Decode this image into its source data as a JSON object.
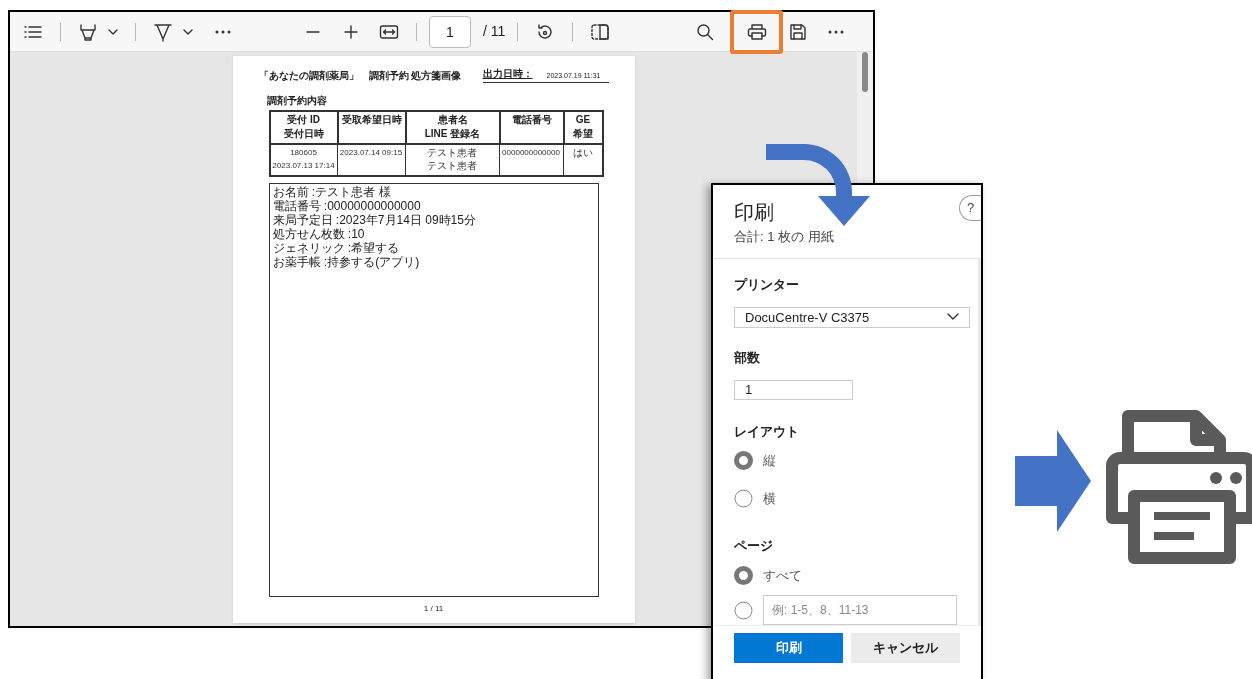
{
  "viewer": {
    "toolbar": {
      "page_number": "1",
      "page_total": "/ 11",
      "print_highlighted": true
    },
    "document": {
      "header_title": "「あなたの調剤薬局」　調剤予約 処方箋画像",
      "output_label": "出力日時：",
      "output_value": "2023.07.19 11:31",
      "section_title": "調剤予約内容",
      "table": {
        "columns": [
          {
            "lines": [
              "受付 ID",
              "受付日時"
            ]
          },
          {
            "lines": [
              "受取希望日時"
            ]
          },
          {
            "lines": [
              "患者名",
              "LINE 登録名"
            ]
          },
          {
            "lines": [
              "電話番号"
            ]
          },
          {
            "lines": [
              "GE",
              "希望"
            ]
          }
        ],
        "rows": [
          {
            "cells": [
              [
                "180605",
                "2023.07.13 17:14"
              ],
              [
                "2023.07.14 09:15"
              ],
              [
                "テスト患者",
                "テスト患者"
              ],
              [
                "0000000000000"
              ],
              [
                "はい"
              ]
            ]
          }
        ]
      },
      "details": [
        "お名前 :テスト患者 様",
        "電話番号 :00000000000000",
        "来局予定日 :2023年7月14日 09時15分",
        "処方せん枚数 :10",
        "ジェネリック :希望する",
        "お薬手帳 :持参する(アプリ)"
      ],
      "footer": "1 / 11"
    }
  },
  "print_dialog": {
    "title": "印刷",
    "subtitle": "合計: 1 枚の 用紙",
    "help": "?",
    "printer_label": "プリンター",
    "printer_value": "DocuCentre-V C3375",
    "copies_label": "部数",
    "copies_value": "1",
    "layout_label": "レイアウト",
    "layout_options": [
      {
        "label": "縦",
        "selected": true
      },
      {
        "label": "横",
        "selected": false
      }
    ],
    "pages_label": "ページ",
    "pages_options": [
      {
        "kind": "all",
        "label": "すべて",
        "selected": true
      },
      {
        "kind": "range",
        "placeholder": "例: 1-5、8、11-13",
        "selected": false
      }
    ],
    "buttons": [
      {
        "kind": "primary",
        "label": "印刷"
      },
      {
        "kind": "secondary",
        "label": "キャンセル"
      }
    ]
  }
}
